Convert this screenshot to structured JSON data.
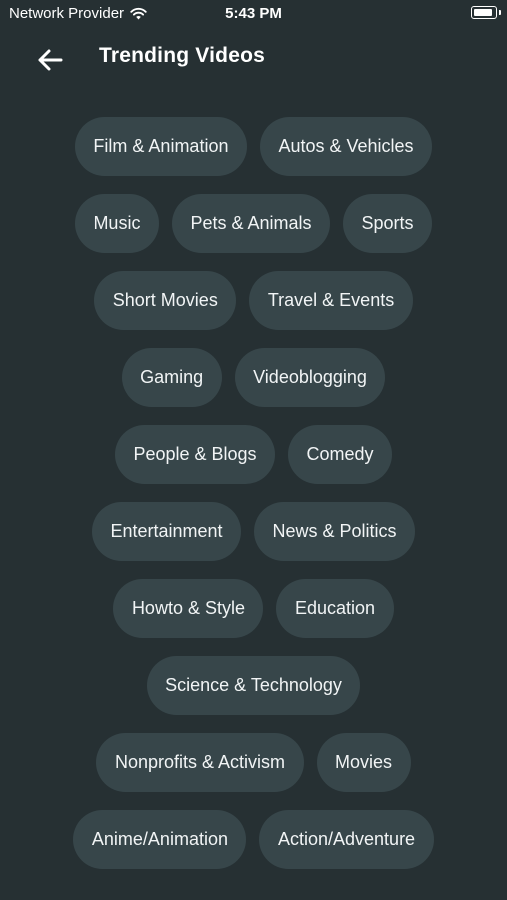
{
  "status_bar": {
    "carrier": "Network Provider",
    "time": "5:43 PM"
  },
  "header": {
    "title": "Trending Videos",
    "back_icon": "arrow-left-icon"
  },
  "categories": [
    [
      "Film & Animation",
      "Autos & Vehicles"
    ],
    [
      "Music",
      "Pets & Animals",
      "Sports"
    ],
    [
      "Short Movies",
      "Travel & Events"
    ],
    [
      "Gaming",
      "Videoblogging"
    ],
    [
      "People & Blogs",
      "Comedy"
    ],
    [
      "Entertainment",
      "News & Politics"
    ],
    [
      "Howto & Style",
      "Education"
    ],
    [
      "Science & Technology"
    ],
    [
      "Nonprofits & Activism",
      "Movies"
    ],
    [
      "Anime/Animation",
      "Action/Adventure"
    ]
  ],
  "colors": {
    "background": "#263033",
    "chip": "#37464a",
    "text": "#ffffff"
  }
}
